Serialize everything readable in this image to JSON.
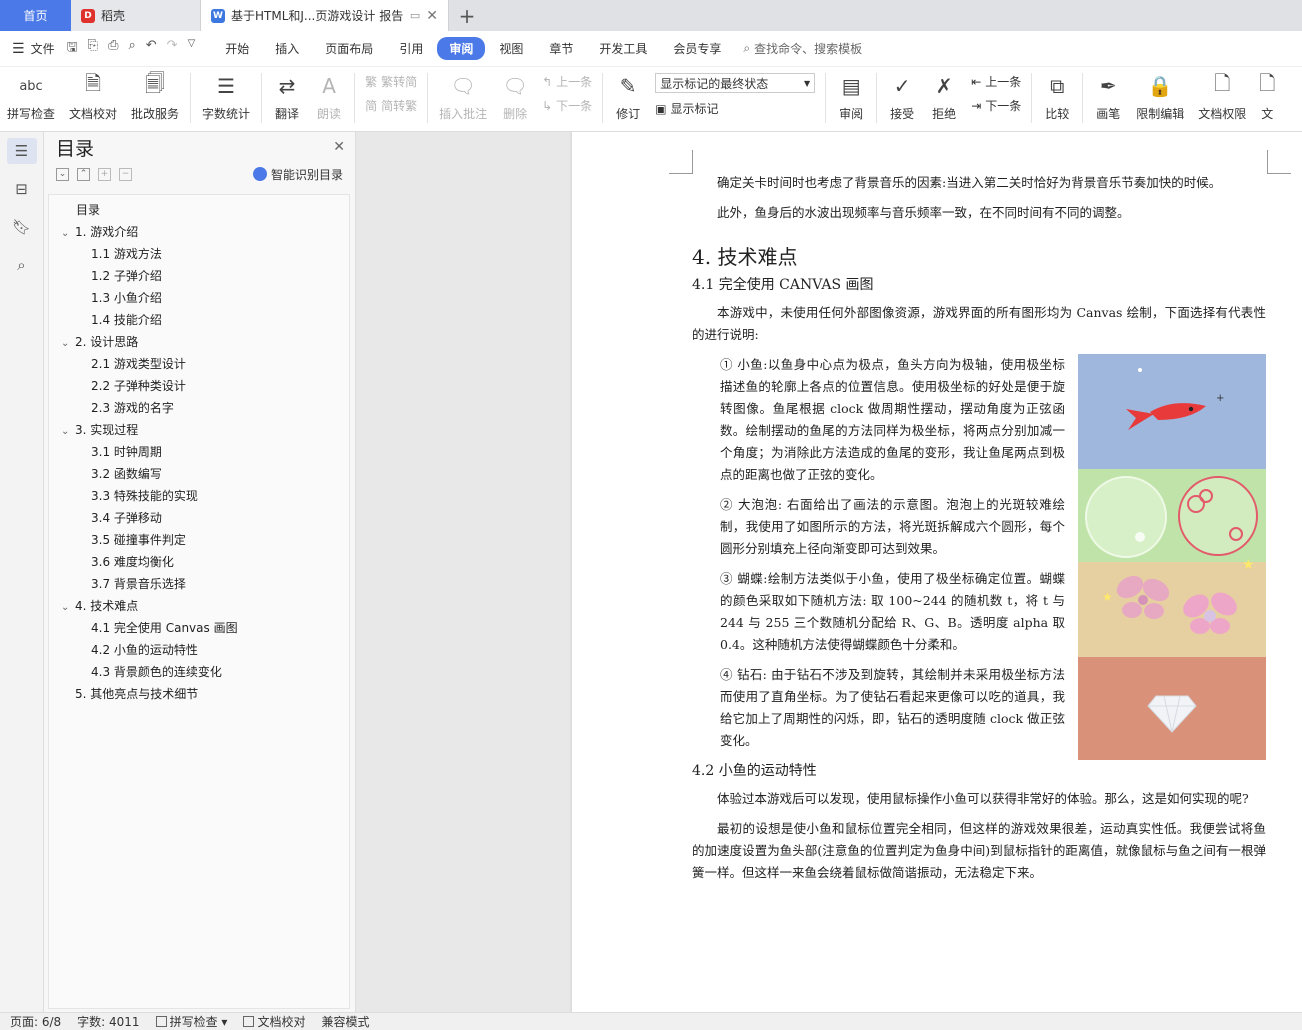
{
  "tabs": {
    "home": "首页",
    "daoke": "稻壳",
    "doc_title": "基于HTML和J...页游戏设计 报告"
  },
  "menubar": {
    "file": "文件",
    "items": [
      "开始",
      "插入",
      "页面布局",
      "引用",
      "审阅",
      "视图",
      "章节",
      "开发工具",
      "会员专享"
    ],
    "active": "审阅",
    "search": "查找命令、搜索模板"
  },
  "ribbon": {
    "spell": "拼写检查",
    "proof": "文档校对",
    "annotate_service": "批改服务",
    "word_count": "字数统计",
    "translate": "翻译",
    "read_aloud": "朗读",
    "trad": "繁转简",
    "simp": "简转繁",
    "insert_comment": "插入批注",
    "delete": "删除",
    "prev": "上一条",
    "next": "下一条",
    "revise": "修订",
    "show_mode": "显示标记的最终状态",
    "show_marks": "显示标记",
    "review": "审阅",
    "accept": "接受",
    "reject": "拒绝",
    "prev2": "上一条",
    "next2": "下一条",
    "compare": "比较",
    "pen": "画笔",
    "restrict": "限制编辑",
    "doc_perm": "文档权限",
    "doc_more": "文"
  },
  "toc": {
    "title": "目录",
    "smart": "智能识别目录",
    "items": [
      {
        "level": 0,
        "text": "目录"
      },
      {
        "level": 1,
        "text": "1. 游戏介绍"
      },
      {
        "level": 2,
        "text": "1.1 游戏方法"
      },
      {
        "level": 2,
        "text": "1.2 子弹介绍"
      },
      {
        "level": 2,
        "text": "1.3 小鱼介绍"
      },
      {
        "level": 2,
        "text": "1.4 技能介绍"
      },
      {
        "level": 1,
        "text": "2. 设计思路"
      },
      {
        "level": 2,
        "text": "2.1 游戏类型设计"
      },
      {
        "level": 2,
        "text": "2.2 子弹种类设计"
      },
      {
        "level": 2,
        "text": "2.3 游戏的名字"
      },
      {
        "level": 1,
        "text": "3. 实现过程"
      },
      {
        "level": 2,
        "text": "3.1 时钟周期"
      },
      {
        "level": 2,
        "text": "3.2 函数编写"
      },
      {
        "level": 2,
        "text": "3.3 特殊技能的实现"
      },
      {
        "level": 2,
        "text": "3.4 子弹移动"
      },
      {
        "level": 2,
        "text": "3.5 碰撞事件判定"
      },
      {
        "level": 2,
        "text": "3.6 难度均衡化"
      },
      {
        "level": 2,
        "text": "3.7 背景音乐选择"
      },
      {
        "level": 1,
        "text": "4. 技术难点"
      },
      {
        "level": 2,
        "text": "4.1 完全使用 Canvas 画图"
      },
      {
        "level": 2,
        "text": "4.2 小鱼的运动特性"
      },
      {
        "level": 2,
        "text": "4.3 背景颜色的连续变化"
      },
      {
        "level": 3,
        "text": "5. 其他亮点与技术细节"
      }
    ]
  },
  "doc": {
    "p1": "确定关卡时间时也考虑了背景音乐的因素:当进入第二关时恰好为背景音乐节奏加快的时候。",
    "p2": "此外，鱼身后的水波出现频率与音乐频率一致，在不同时间有不同的调整。",
    "h_4": "4. 技术难点",
    "h_41": "4.1 完全使用 CANVAS 画图",
    "p3": "本游戏中，未使用任何外部图像资源，游戏界面的所有图形均为 Canvas 绘制，下面选择有代表性的进行说明:",
    "li1": "① 小鱼:以鱼身中心点为极点，鱼头方向为极轴，使用极坐标描述鱼的轮廓上各点的位置信息。使用极坐标的好处是便于旋转图像。鱼尾根据 clock 做周期性摆动，摆动角度为正弦函数。绘制摆动的鱼尾的方法同样为极坐标，将两点分别加减一个角度；为消除此方法造成的鱼尾的变形，我让鱼尾两点到极点的距离也做了正弦的变化。",
    "li2": "② 大泡泡: 右面给出了画法的示意图。泡泡上的光斑较难绘制，我使用了如图所示的方法，将光斑拆解成六个圆形，每个圆形分别填充上径向渐变即可达到效果。",
    "li3": "③ 蝴蝶:绘制方法类似于小鱼，使用了极坐标确定位置。蝴蝶的颜色采取如下随机方法: 取 100~244 的随机数 t，将 t 与 244 与 255 三个数随机分配给 R、G、B。透明度 alpha 取 0.4。这种随机方法使得蝴蝶颜色十分柔和。",
    "li4": "④ 钻石: 由于钻石不涉及到旋转，其绘制并未采用极坐标方法而使用了直角坐标。为了使钻石看起来更像可以吃的道具，我给它加上了周期性的闪烁，即，钻石的透明度随 clock 做正弦变化。",
    "h_42": "4.2 小鱼的运动特性",
    "p4": "体验过本游戏后可以发现，使用鼠标操作小鱼可以获得非常好的体验。那么，这是如何实现的呢?",
    "p5": "最初的设想是使小鱼和鼠标位置完全相同，但这样的游戏效果很差，运动真实性低。我便尝试将鱼的加速度设置为鱼头部(注意鱼的位置判定为鱼身中间)到鼠标指针的距离值，就像鼠标与鱼之间有一根弹簧一样。但这样一来鱼会绕着鼠标做简谐振动，无法稳定下来。"
  },
  "status": {
    "page": "页面: 6/8",
    "words": "字数: 4011",
    "spell": "拼写检查",
    "proof": "文档校对",
    "compat": "兼容模式"
  },
  "colors": {
    "accent": "#4b79e7",
    "fish_panel": "#9fb7dc",
    "bubble_panel": "#bfe3a8",
    "butterfly_panel": "#e6cfa0",
    "diamond_panel": "#d9917a"
  }
}
